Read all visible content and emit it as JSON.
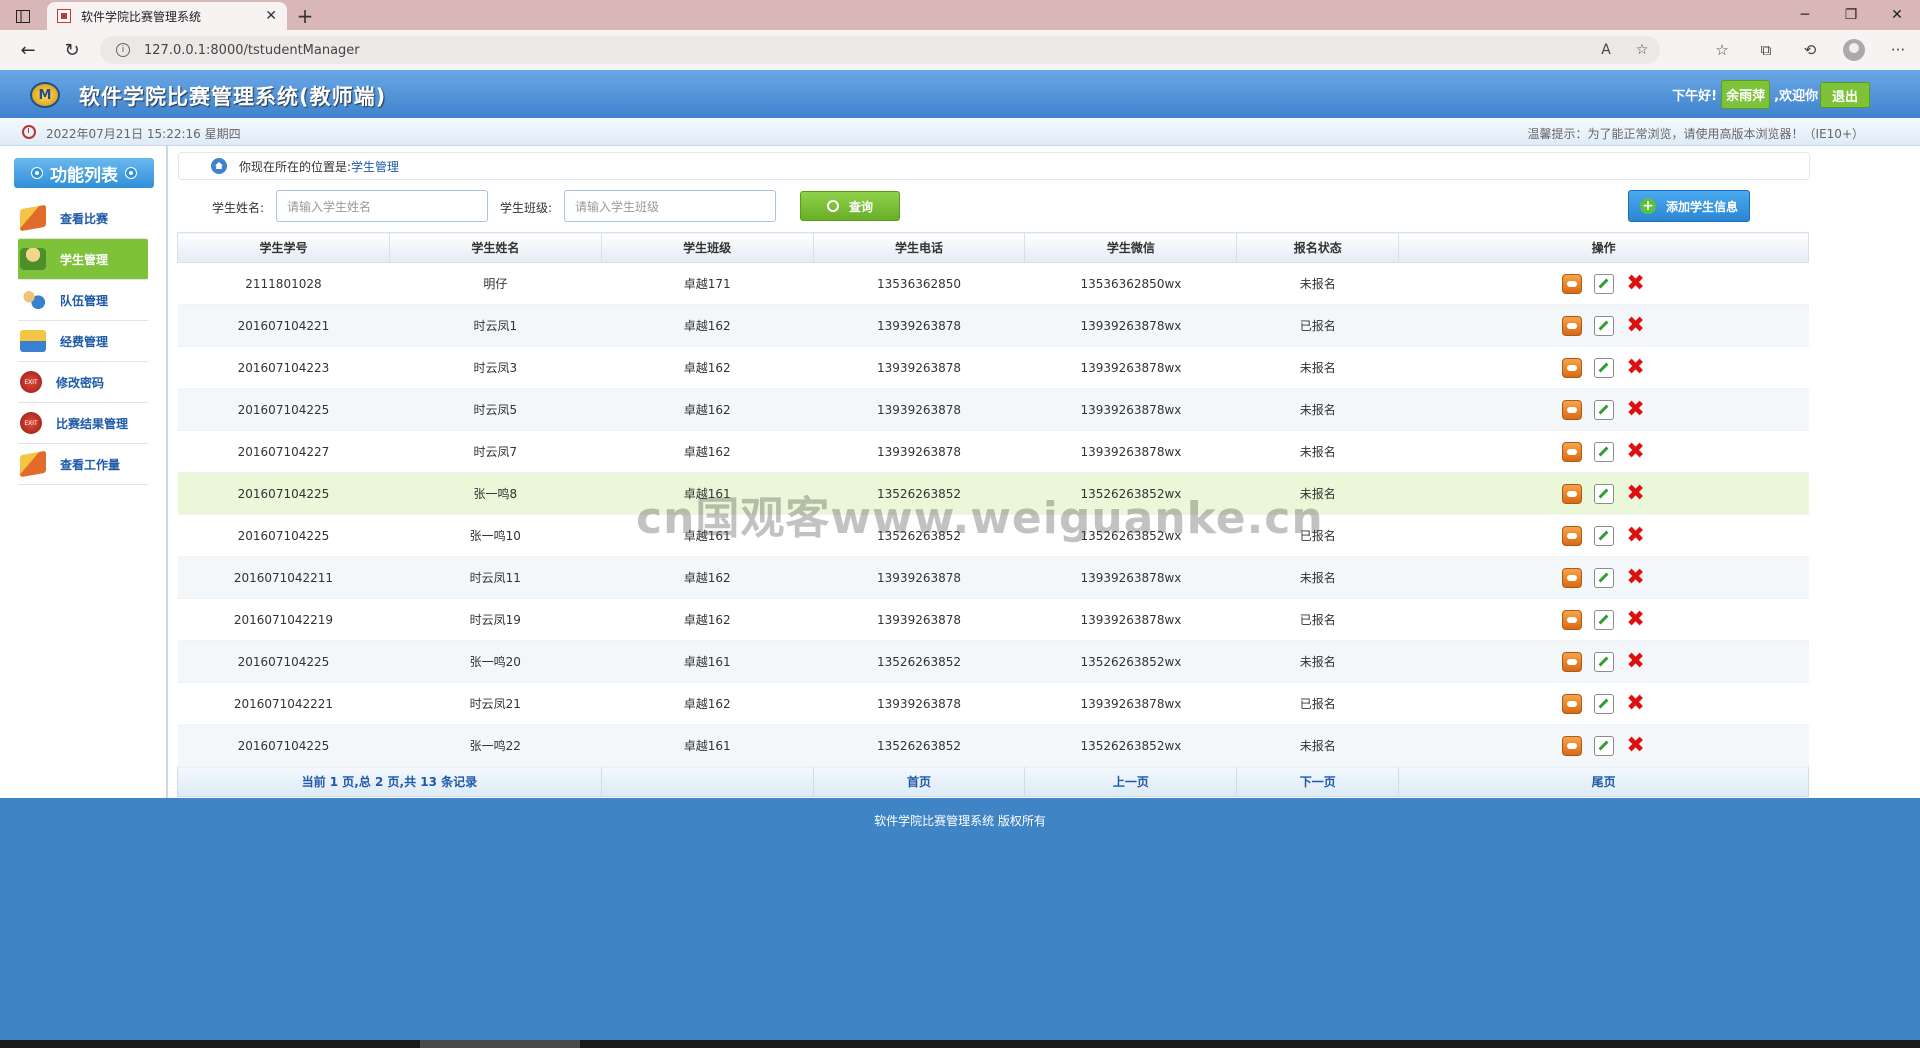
{
  "browser": {
    "tab_title": "软件学院比赛管理系统",
    "url": "127.0.0.1:8000/tstudentManager"
  },
  "header": {
    "app_title": "软件学院比赛管理系统(教师端)",
    "logo_text": "M",
    "greeting": "下午好!",
    "username": "余雨萍",
    "welcome": ",欢迎你!",
    "logout_label": "退出"
  },
  "subheader": {
    "datetime": "2022年07月21日 15:22:16 星期四",
    "tip": "温馨提示：为了能正常浏览，请使用高版本浏览器！（IE10+）"
  },
  "sidebar": {
    "title": "功能列表",
    "items": [
      {
        "label": "查看比赛",
        "icon": "book-icon"
      },
      {
        "label": "学生管理",
        "icon": "student-icon",
        "active": true
      },
      {
        "label": "队伍管理",
        "icon": "team-icon"
      },
      {
        "label": "经费管理",
        "icon": "money-icon"
      },
      {
        "label": "修改密码",
        "icon": "exit-icon"
      },
      {
        "label": "比赛结果管理",
        "icon": "exit-icon"
      },
      {
        "label": "查看工作量",
        "icon": "book-icon"
      }
    ]
  },
  "breadcrumb": {
    "prefix": "你现在所在的位置是:",
    "current": "学生管理"
  },
  "search": {
    "name_label": "学生姓名:",
    "name_placeholder": "请输入学生姓名",
    "class_label": "学生班级:",
    "class_placeholder": "请输入学生班级",
    "query_label": "查询",
    "add_label": "添加学生信息"
  },
  "table": {
    "columns": [
      "学生学号",
      "学生姓名",
      "学生班级",
      "学生电话",
      "学生微信",
      "报名状态",
      "操作"
    ],
    "rows": [
      [
        "2111801028",
        "明仔",
        "卓越171",
        "13536362850",
        "13536362850wx",
        "未报名"
      ],
      [
        "201607104221",
        "时云凤1",
        "卓越162",
        "13939263878",
        "13939263878wx",
        "已报名"
      ],
      [
        "201607104223",
        "时云凤3",
        "卓越162",
        "13939263878",
        "13939263878wx",
        "未报名"
      ],
      [
        "201607104225",
        "时云凤5",
        "卓越162",
        "13939263878",
        "13939263878wx",
        "未报名"
      ],
      [
        "201607104227",
        "时云凤7",
        "卓越162",
        "13939263878",
        "13939263878wx",
        "未报名"
      ],
      [
        "201607104225",
        "张一鸣8",
        "卓越161",
        "13526263852",
        "13526263852wx",
        "未报名"
      ],
      [
        "201607104225",
        "张一鸣10",
        "卓越161",
        "13526263852",
        "13526263852wx",
        "已报名"
      ],
      [
        "2016071042211",
        "时云凤11",
        "卓越162",
        "13939263878",
        "13939263878wx",
        "未报名"
      ],
      [
        "2016071042219",
        "时云凤19",
        "卓越162",
        "13939263878",
        "13939263878wx",
        "已报名"
      ],
      [
        "201607104225",
        "张一鸣20",
        "卓越161",
        "13526263852",
        "13526263852wx",
        "未报名"
      ],
      [
        "2016071042221",
        "时云凤21",
        "卓越162",
        "13939263878",
        "13939263878wx",
        "已报名"
      ],
      [
        "201607104225",
        "张一鸣22",
        "卓越161",
        "13526263852",
        "13526263852wx",
        "未报名"
      ]
    ],
    "highlighted_row": 5
  },
  "pager": {
    "summary": "当前 1 页,总 2 页,共 13 条记录",
    "first": "首页",
    "prev": "上一页",
    "next": "下一页",
    "last": "尾页"
  },
  "footer": {
    "copyright": "软件学院比赛管理系统 版权所有"
  },
  "watermark": "cn国观客www.weiguanke.cn",
  "colors": {
    "header_blue": "#3f82cd",
    "accent_green": "#7ec23a",
    "footer_blue": "#3f85c5",
    "delete_red": "#dd1111"
  }
}
